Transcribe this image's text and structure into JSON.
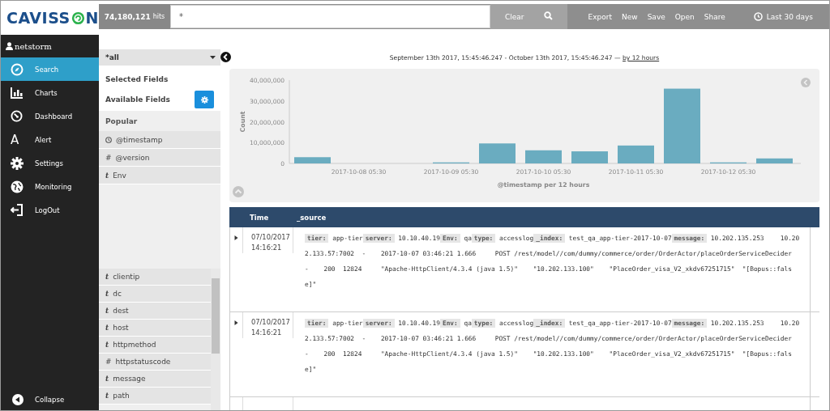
{
  "logo": {
    "before": "CAVISS",
    "after": "N"
  },
  "user": {
    "name": "netstorm"
  },
  "nav": [
    {
      "label": "Search",
      "selected": true
    },
    {
      "label": "Charts",
      "selected": false
    },
    {
      "label": "Dashboard",
      "selected": false
    },
    {
      "label": "Alert",
      "glyph": "A",
      "selected": false
    },
    {
      "label": "Settings",
      "selected": false
    },
    {
      "label": "Monitoring",
      "selected": false
    },
    {
      "label": "LogOut",
      "selected": false
    }
  ],
  "collapse": {
    "label": "Collapse"
  },
  "header": {
    "hits": "**74,180,121** hits",
    "query": "*",
    "clear": "Clear",
    "actions": [
      "Export",
      "New",
      "Save",
      "Open",
      "Share"
    ],
    "time_range": "Last 30 days"
  },
  "fields_panel": {
    "index_pattern": "*all",
    "selected_title": "Selected Fields",
    "available_title": "Available Fields",
    "popular_title": "Popular",
    "popular": [
      {
        "kind": "date",
        "name": "@timestamp"
      },
      {
        "kind": "number",
        "symbol": "#",
        "name": "@version"
      },
      {
        "kind": "string",
        "symbol": "t",
        "name": "Env"
      }
    ],
    "fields": [
      {
        "kind": "string",
        "symbol": "t",
        "name": "clientip"
      },
      {
        "kind": "string",
        "symbol": "t",
        "name": "dc"
      },
      {
        "kind": "string",
        "symbol": "t",
        "name": "dest"
      },
      {
        "kind": "string",
        "symbol": "t",
        "name": "host"
      },
      {
        "kind": "string",
        "symbol": "t",
        "name": "httpmethod"
      },
      {
        "kind": "number",
        "symbol": "#",
        "name": "httpstatuscode"
      },
      {
        "kind": "string",
        "symbol": "t",
        "name": "message"
      },
      {
        "kind": "string",
        "symbol": "t",
        "name": "path"
      }
    ]
  },
  "date_range": {
    "text": "September 13th 2017, 15:45:46.247 - October 13th 2017, 15:45:46.247 —",
    "link": "by 12 hours"
  },
  "histogram": {
    "chart_data": {
      "type": "bar",
      "xlabel": "@timestamp per 12 hours",
      "ylabel": "Count",
      "values": [
        3000000,
        0,
        0,
        500000,
        9600000,
        6300000,
        5800000,
        8600000,
        35900000,
        500000,
        2400000
      ],
      "ylim": [
        0,
        40000000
      ],
      "yticks": [
        {
          "value": 0,
          "label": "0"
        },
        {
          "value": 10000000,
          "label": "10,000,000"
        },
        {
          "value": 20000000,
          "label": "20,000,000"
        },
        {
          "value": 30000000,
          "label": "30,000,000"
        },
        {
          "value": 40000000,
          "label": "40,000,000"
        }
      ],
      "categories": [
        null,
        "2017-10-08 05:30",
        null,
        "2017-10-09 05:30",
        null,
        "2017-10-10 05:30",
        null,
        "2017-10-11 05:30",
        null,
        "2017-10-12 05:30",
        null
      ]
    }
  },
  "table": {
    "columns": [
      "Time",
      "_source"
    ],
    "rows": [
      {
        "expanded": false,
        "time": "07/10/2017 14:16:21",
        "fields": [
          {
            "key": "tier:",
            "value": "app-tier"
          },
          {
            "key": "server:",
            "value": "10.10.40.19"
          },
          {
            "key": "Env:",
            "value": "qa"
          },
          {
            "key": "type:",
            "value": "accesslog"
          },
          {
            "key": "_index:",
            "value": "test_qa_app-tier-2017-10-07"
          },
          {
            "key": "message:",
            "value": "10.202.135.253\t10.202.133.57:7002\t-\t2017-10-07 03:46:21\t1.666\tPOST\t/rest/model//com/dummy/commerce/order/OrderActor/placeOrderServiceDecider\t-\t200\t12824\t\"Apache-HttpClient/4.3.4 (java 1.5)\"\t\"10.202.133.100\"\t\"PlaceOrder_visa_V2_xkdv67251715\"\t\"[Bopus::false]\""
          }
        ]
      },
      {
        "expanded": false,
        "time": "07/10/2017 14:16:21",
        "fields": [
          {
            "key": "tier:",
            "value": "app-tier"
          },
          {
            "key": "server:",
            "value": "10.10.40.19"
          },
          {
            "key": "Env:",
            "value": "qa"
          },
          {
            "key": "type:",
            "value": "accesslog"
          },
          {
            "key": "_index:",
            "value": "test_qa_app-tier-2017-10-07"
          },
          {
            "key": "message:",
            "value": "10.202.135.253\t10.202.133.57:7002\t-\t2017-10-07 03:46:21\t1.666\tPOST\t/rest/model//com/dummy/commerce/order/OrderActor/placeOrderServiceDecider\t-\t200\t12824\t\"Apache-HttpClient/4.3.4 (java 1.5)\"\t\"10.202.133.100\"\t\"PlaceOrder_visa_V2_xkdv67251715\"\t\"[Bopus::false]\""
          }
        ]
      }
    ]
  }
}
